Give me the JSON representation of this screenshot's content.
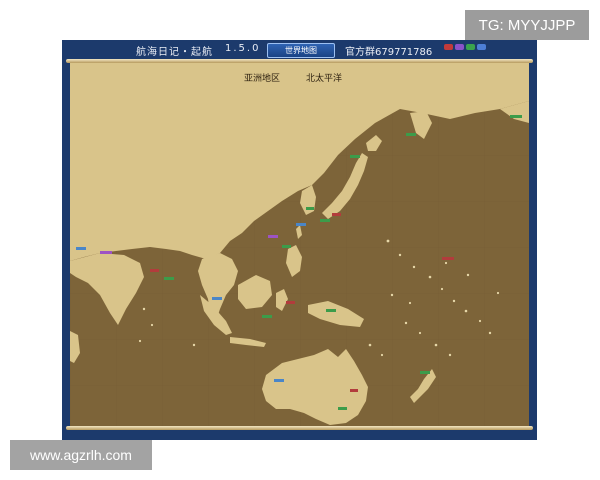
{
  "watermarks": {
    "tg": "TG: MYYJJPP",
    "site": "www.agzrlh.com"
  },
  "window": {
    "title": "航海日记・起航",
    "version": "1.5.0",
    "map_tab": "世界地图",
    "group": "官方群679771786"
  },
  "map": {
    "regions": [
      {
        "id": "asia",
        "text": "亚洲地区"
      },
      {
        "id": "north-pacific",
        "text": "北太平洋"
      }
    ]
  },
  "colors": {
    "frame": "#1c3a6c",
    "land": "#d9c48a",
    "sea": "#7d6439",
    "tab": "#2f63b3"
  },
  "icons": [
    "map-scroll-rod",
    "port-marker-icon",
    "island-dot-icon"
  ]
}
